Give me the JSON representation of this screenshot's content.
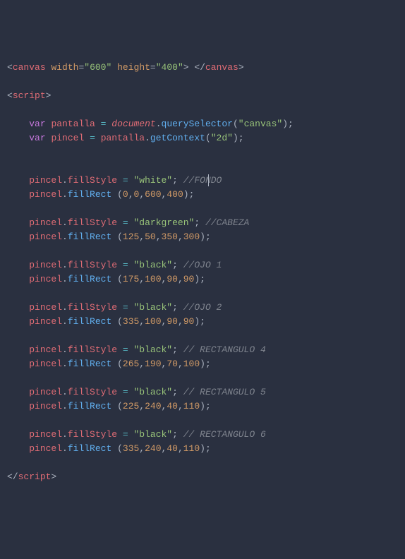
{
  "tokens": {
    "lt": "<",
    "gt": ">",
    "lt_close": "</",
    "eq": "=",
    "quote": "\"",
    "semi": ";",
    "dot": ".",
    "comma": ",",
    "lparen": "(",
    "rparen": ")",
    "space": " "
  },
  "tags": {
    "canvas": "canvas",
    "script": "script"
  },
  "attrs": {
    "width": "width",
    "height": "height"
  },
  "attrvals": {
    "w600": "600",
    "h400": "400"
  },
  "kw": {
    "var": "var"
  },
  "ids": {
    "pantalla": "pantalla",
    "pincel": "pincel",
    "document": "document"
  },
  "funcs": {
    "querySelector": "querySelector",
    "getContext": "getContext",
    "fillRect": "fillRect"
  },
  "props": {
    "fillStyle": "fillStyle"
  },
  "strings": {
    "canvas": "\"canvas\"",
    "twod": "\"2d\"",
    "white": "\"white\"",
    "darkgreen": "\"darkgreen\"",
    "black": "\"black\""
  },
  "nums": {
    "n0": "0",
    "n600": "600",
    "n400": "400",
    "n125": "125",
    "n50": "50",
    "n350": "350",
    "n300": "300",
    "n175": "175",
    "n100": "100",
    "n90": "90",
    "n335": "335",
    "n265": "265",
    "n190": "190",
    "n70": "70",
    "n225": "225",
    "n240": "240",
    "n40": "40",
    "n110": "110"
  },
  "comments": {
    "fondo": "//FONDO",
    "cabeza": "//CABEZA",
    "ojo1": "//OJO 1",
    "ojo2": "//OJO 2",
    "rect4": "// RECTANGULO 4",
    "rect5": "// RECTANGULO 5",
    "rect6": "// RECTANGULO 6"
  },
  "indent": {
    "i1": "    ",
    "i2": "        "
  }
}
